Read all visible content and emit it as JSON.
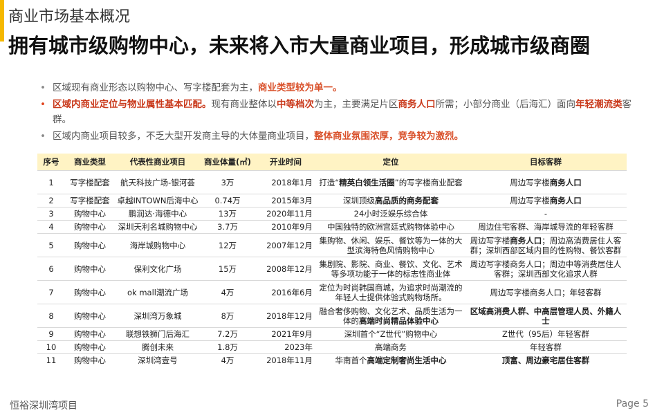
{
  "section_title": "商业市场基本概况",
  "main_title": "拥有城市级购物中心，未来将入市大量商业项目，形成城市级商圈",
  "bullets": [
    {
      "pre": "区域现有商业形态以购物中心、写字楼配套为主，",
      "hl": "商业类型较为单一。"
    },
    {
      "hl1": "区域内商业定位与物业属性基本匹配。",
      "t1": "现有商业整体以",
      "hl2": "中等档次",
      "t2": "为主，主要满足片区",
      "hl3": "商务人口",
      "t3": "所需；小部分商业（后海汇）面向",
      "hl4": "年轻潮流类",
      "t4": "客群。"
    },
    {
      "pre": "区域内商业项目较多，不乏大型开发商主导的大体量商业项目，",
      "hl": "整体商业氛围浓厚，竞争较为激烈。"
    }
  ],
  "table": {
    "headers": [
      "序号",
      "商业类型",
      "代表性商业项目",
      "商业体量(㎡)",
      "开业时间",
      "定位",
      "目标客群"
    ],
    "rows": [
      {
        "no": "1",
        "type": "写字楼配套",
        "project": "航天科技广场-银河荟",
        "area": "3万",
        "open": "2018年1月",
        "pos_a": "打造“",
        "pos_b": "精英白领生活圈",
        "pos_c": "”的写字楼商业配套",
        "tgt_a": "周边写字楼",
        "tgt_b": "商务人口",
        "tgt_c": ""
      },
      {
        "no": "2",
        "type": "写字楼配套",
        "project": "卓越INTOWN后海中心",
        "area": "0.74万",
        "open": "2015年3月",
        "pos_a": "深圳顶级",
        "pos_b": "高品质的商务配套",
        "pos_c": "",
        "tgt_a": "周边写字楼",
        "tgt_b": "商务人口",
        "tgt_c": ""
      },
      {
        "no": "3",
        "type": "购物中心",
        "project": "鹏润达·海德中心",
        "area": "13万",
        "open": "2020年11月",
        "pos_a": "24小时泛娱乐综合体",
        "pos_b": "",
        "pos_c": "",
        "tgt_a": "-",
        "tgt_b": "",
        "tgt_c": ""
      },
      {
        "no": "4",
        "type": "购物中心",
        "project": "深圳天利名城购物中心",
        "area": "3.7万",
        "open": "2010年9月",
        "pos_a": "中国独特的欧洲宫廷式购物体验中心",
        "pos_b": "",
        "pos_c": "",
        "tgt_a": "周边住宅客群、海岸城导流的年轻客群",
        "tgt_b": "",
        "tgt_c": ""
      },
      {
        "no": "5",
        "type": "购物中心",
        "project": "海岸城购物中心",
        "area": "12万",
        "open": "2007年12月",
        "pos_a": "集购物、休闲、娱乐、餐饮等为一体的大型滨海特色风情购物中心",
        "pos_b": "",
        "pos_c": "",
        "tgt_a": "周边写字楼",
        "tgt_b": "商务人口",
        "tgt_c": "；周边高消费居住人客群；深圳西部区域内目的性购物、餐饮客群"
      },
      {
        "no": "6",
        "type": "购物中心",
        "project": "保利文化广场",
        "area": "15万",
        "open": "2008年12月",
        "pos_a": "集剧院、影院、商业、餐饮、文化、艺术等多项功能于一体的标志性商业体",
        "pos_b": "",
        "pos_c": "",
        "tgt_a": "周边写字楼商务人口；周边中等消费居住人客群；深圳西部文化追求人群",
        "tgt_b": "",
        "tgt_c": ""
      },
      {
        "no": "7",
        "type": "购物中心",
        "project": "ok mall潮流广场",
        "area": "4万",
        "open": "2016年6月",
        "pos_a": "定位为时尚韩国商城，为追求时尚潮流的年轻人士提供体验式购物场所。",
        "pos_b": "",
        "pos_c": "",
        "tgt_a": "周边写字楼商务人口；年轻客群",
        "tgt_b": "",
        "tgt_c": ""
      },
      {
        "no": "8",
        "type": "购物中心",
        "project": "深圳湾万象城",
        "area": "8万",
        "open": "2018年12月",
        "pos_a": "融合奢侈购物、文化艺术、品质生活为一体的",
        "pos_b": "高端时尚精品体验中心",
        "pos_c": "",
        "tgt_a": "",
        "tgt_b": "区域高消费人群、中高层管理人员、外籍人士",
        "tgt_c": ""
      },
      {
        "no": "9",
        "type": "购物中心",
        "project": "联想铁狮门后海汇",
        "area": "7.2万",
        "open": "2021年9月",
        "pos_a": "深圳首个“Z世代”购物中心",
        "pos_b": "",
        "pos_c": "",
        "tgt_a": "Z世代（95后）年轻客群",
        "tgt_b": "",
        "tgt_c": ""
      },
      {
        "no": "10",
        "type": "购物中心",
        "project": "腾创未来",
        "area": "1.8万",
        "open": "2023年",
        "pos_a": "高端商务",
        "pos_b": "",
        "pos_c": "",
        "tgt_a": "年轻客群",
        "tgt_b": "",
        "tgt_c": ""
      },
      {
        "no": "11",
        "type": "购物中心",
        "project": "深圳湾壹号",
        "area": "4万",
        "open": "2018年11月",
        "pos_a": "华南首个",
        "pos_b": "高端定制奢尚生活中心",
        "pos_c": "",
        "tgt_a": "",
        "tgt_b": "顶富、周边豪宅居住客群",
        "tgt_c": ""
      }
    ]
  },
  "footer": {
    "left": "恒裕深圳湾项目",
    "right": "Page 5"
  },
  "colors": {
    "accent": "#f5b800",
    "highlight": "#d9502a",
    "header_bg": "#fff3c4"
  }
}
